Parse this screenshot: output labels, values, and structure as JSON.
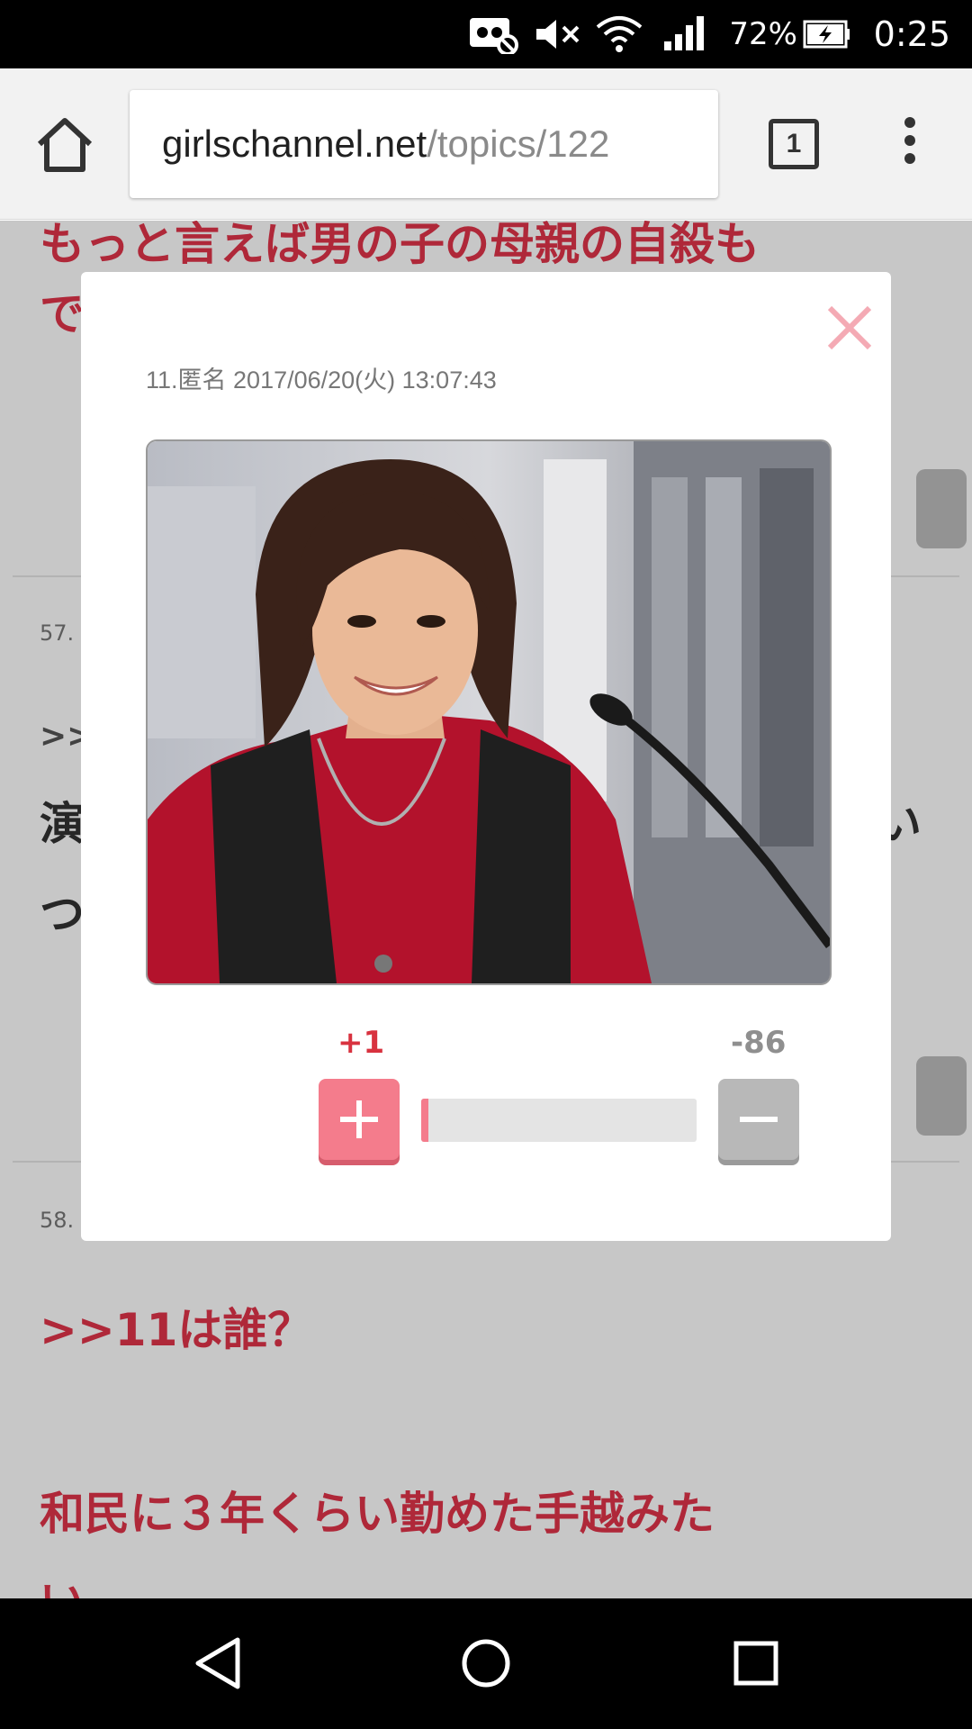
{
  "status_bar": {
    "battery": "72%",
    "time": "0:25"
  },
  "browser": {
    "url_domain": "girlschannel.net",
    "url_path": "/topics/122",
    "tab_count": "1"
  },
  "page": {
    "line1": "もっと言えば男の子の母親の自殺も",
    "line2": "で",
    "comment57_number": "57.",
    "comment57_ref": ">>",
    "comment57_char1": "演",
    "comment57_char2": "つ",
    "comment57_tail": "い",
    "comment58_number": "58.",
    "comment58_reply": ">>11は誰？",
    "comment58_body1": "和民に３年くらい勤めた手越みた",
    "comment58_body2": "い。"
  },
  "modal": {
    "meta": "11.匿名 2017/06/20(火) 13:07:43",
    "plus_count": "+1",
    "minus_count": "-86",
    "plus_ratio": 0.0115
  },
  "colors": {
    "accent_red": "#e0344a",
    "plus_pink": "#f47c8c",
    "minus_gray": "#b8b8b8"
  },
  "icons": [
    "home-icon",
    "tab-switcher-icon",
    "overflow-menu-icon",
    "close-icon",
    "plus-icon",
    "minus-icon",
    "back-icon",
    "home-nav-icon",
    "recents-icon",
    "mute-icon",
    "wifi-icon",
    "signal-icon",
    "battery-icon"
  ]
}
